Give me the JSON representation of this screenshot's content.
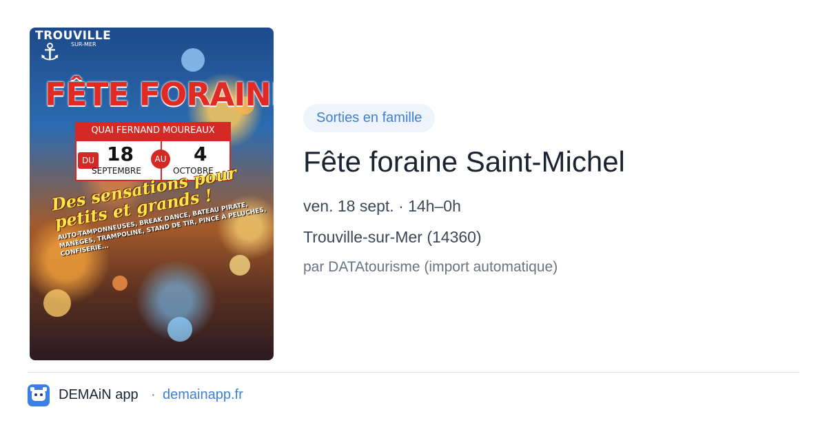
{
  "poster": {
    "logo_text": "TROUVILLE",
    "logo_sub": "SUR-MER",
    "title": "FÊTE FORAINE",
    "address": "QUAI FERNAND MOUREAUX",
    "du": "DU",
    "start_day": "18",
    "start_month": "SEPTEMBRE",
    "au": "AU",
    "end_day": "4",
    "end_month": "OCTOBRE",
    "slogan": "Des sensations pour petits et grands !",
    "rides": "AUTO-TAMPONNEUSES, BREAK DANCE, BATEAU PIRATE, MANÈGES, TRAMPOLINE, STAND DE TIR, PINCE À PELUCHES, CONFISERIE..."
  },
  "event": {
    "category": "Sorties en famille",
    "title": "Fête foraine Saint-Michel",
    "date": "ven. 18 sept. · 14h–0h",
    "location": "Trouville-sur-Mer (14360)",
    "author": "par DATAtourisme (import automatique)"
  },
  "footer": {
    "app_name": "DEMAiN app",
    "separator": "·",
    "url": "demainapp.fr"
  },
  "colors": {
    "accent": "#3d7fd6",
    "tag_bg": "#eef4fc",
    "title": "#1b2230",
    "poster_red": "#d42a26"
  }
}
